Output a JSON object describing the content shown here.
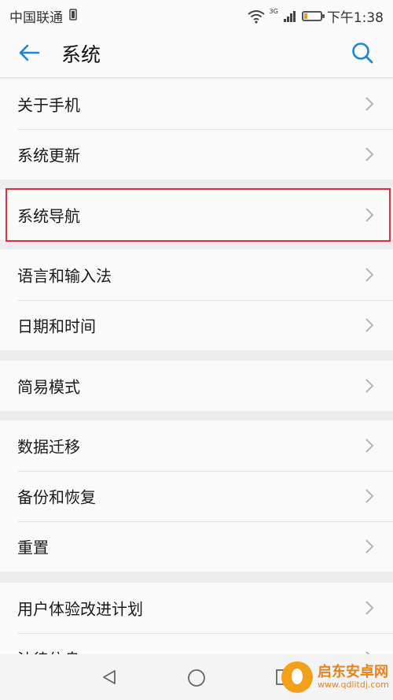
{
  "status_bar": {
    "carrier": "中国联通",
    "network": "3G",
    "time": "下午1:38",
    "battery_percent": 20
  },
  "header": {
    "title": "系统",
    "back_icon": "arrow-left-icon",
    "search_icon": "search-icon"
  },
  "groups": [
    {
      "items": [
        {
          "label": "关于手机"
        },
        {
          "label": "系统更新"
        }
      ]
    },
    {
      "items": [
        {
          "label": "系统导航"
        }
      ]
    },
    {
      "items": [
        {
          "label": "语言和输入法"
        },
        {
          "label": "日期和时间"
        }
      ]
    },
    {
      "items": [
        {
          "label": "简易模式"
        }
      ]
    },
    {
      "items": [
        {
          "label": "数据迁移"
        },
        {
          "label": "备份和恢复"
        },
        {
          "label": "重置"
        }
      ]
    },
    {
      "items": [
        {
          "label": "用户体验改进计划"
        },
        {
          "label": "法律信息"
        }
      ]
    }
  ],
  "colors": {
    "accent": "#1e88d8",
    "highlight_border": "#e0313a",
    "battery": "#f29b21"
  },
  "watermark": {
    "title": "启东安卓网",
    "url": "www.qdlitdj.com"
  }
}
